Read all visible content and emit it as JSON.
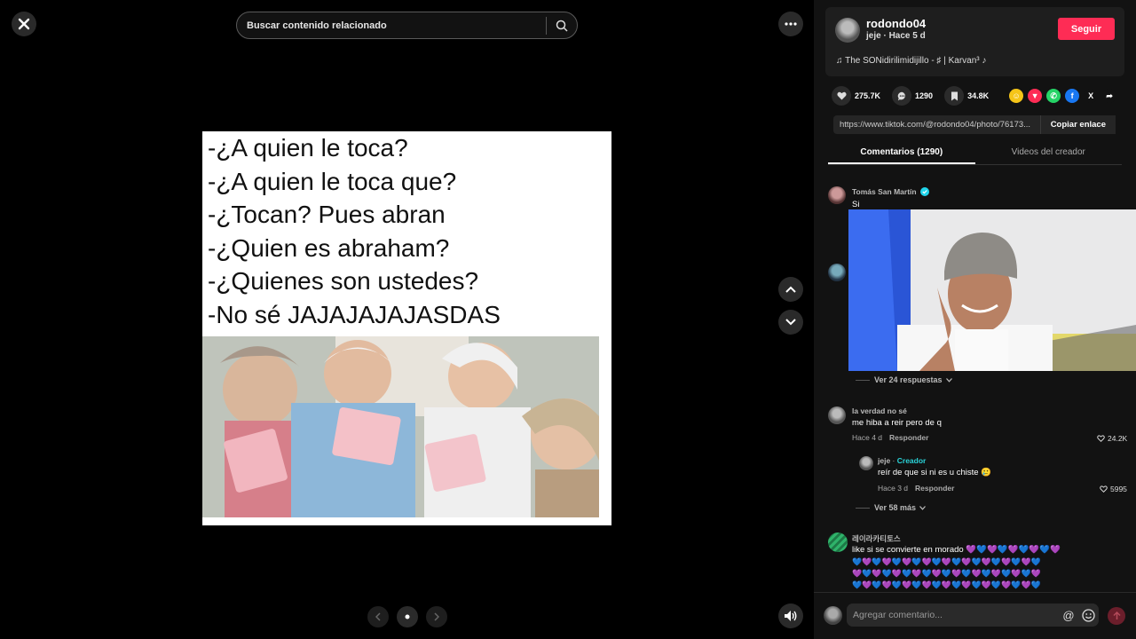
{
  "search": {
    "placeholder": "Buscar contenido relacionado"
  },
  "meme": {
    "lines": [
      "-¿A quien le toca?",
      "-¿A quien le toca que?",
      "-¿Tocan? Pues abran",
      "-¿Quien es abraham?",
      "-¿Quienes son ustedes?",
      "-No sé JAJAJAJAJASDAS"
    ]
  },
  "author": {
    "username": "rodondo04",
    "subline": "jeje · Hace 5 d",
    "follow_label": "Seguir",
    "music": "♫  The SONidirilimidijillo - ♯ | Karvan³ ♪"
  },
  "stats": {
    "likes": "275.7K",
    "comments": "1290",
    "saves": "34.8K"
  },
  "share": {
    "link": "https://www.tiktok.com/@rodondo04/photo/76173...",
    "copy_label": "Copiar enlace"
  },
  "tabs": [
    "Comentarios (1290)",
    "Videos del creador"
  ],
  "comments": [
    {
      "user": "Tomás San Martín",
      "text": "Si",
      "replies": "Ver 24 respuestas"
    },
    {
      "user": "la verdad no sé",
      "text": "me hiba a reir pero de q",
      "date": "Hace 4 d",
      "reply_label": "Responder",
      "likes": "24.2K"
    },
    {
      "user": "jeje",
      "badge": "Creador",
      "text": "reír de que si ni es u chiste 🥲",
      "date": "Hace 3 d",
      "reply_label": "Responder",
      "likes": "5995",
      "more": "Ver 58 más"
    },
    {
      "user": "레이라카티토스",
      "text": "like si se convierte en morado 💜💙💜💙💜💙💜💙💜"
    }
  ],
  "hearts_rows": [
    "💙💜💙💜💙💜💙💜💙💜💙💜💙💜💙💜💙💜💙",
    "💜💙💜💙💜💙💜💙💜💙💜💙💜💙💜💙💜💙💜",
    "💙💜💙💜💙💜💙💜💙💜💙💜💙💜💙💜💙💜💙"
  ],
  "composer": {
    "placeholder": "Agregar comentario..."
  },
  "colors": {
    "brand": "#fe2c55",
    "panel": "#121212",
    "creator": "#2ad4d9"
  }
}
